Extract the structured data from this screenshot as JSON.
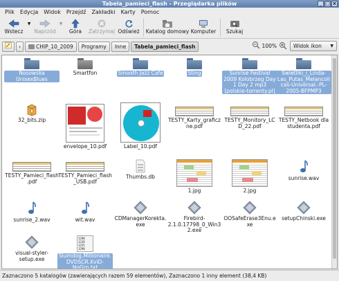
{
  "window": {
    "title": "Tabela_pamieci_flash - Przeglądarka plików",
    "controls": [
      "_",
      "□",
      "x"
    ]
  },
  "menu": [
    "Plik",
    "Edycja",
    "Widok",
    "Przejdź",
    "Zakładki",
    "Karty",
    "Pomoc"
  ],
  "toolbar": {
    "back": "Wstecz",
    "forward": "Naprzód",
    "up": "Góra",
    "stop": "Zatrzymaj",
    "reload": "Odśwież",
    "home": "Katalog domowy",
    "computer": "Komputer",
    "search": "Szukaj"
  },
  "location": {
    "path": [
      "CHIP_10_2009",
      "Programy",
      "Inne",
      "Tabela_pamieci_flash"
    ],
    "zoom": "100%",
    "view": "Widok ikon"
  },
  "files": [
    {
      "name": "Nosowska UnisexBlues",
      "kind": "folder",
      "selected": true
    },
    {
      "name": "Smartfon",
      "kind": "folder",
      "selected": false
    },
    {
      "name": "Smooth Jazz Cafe",
      "kind": "folder",
      "selected": true
    },
    {
      "name": "Sting",
      "kind": "folder",
      "selected": true
    },
    {
      "name": "Sunrise Festival 2009 Kołobrzeg Day 1 Day 2 mp3 [polskie-torrenty.pl]",
      "kind": "folder",
      "selected": true
    },
    {
      "name": "Swietliki_i_Linda-Las_Putas_Melancolicas-Universal.-PL-2005-BFPMP3",
      "kind": "folder",
      "selected": true
    },
    {
      "name": "32_bits.zip",
      "kind": "zip",
      "selected": false
    },
    {
      "name": "envelope_10.pdf",
      "kind": "pdf-envelope",
      "selected": false
    },
    {
      "name": "Label_10.pdf",
      "kind": "pdf-cd",
      "selected": false
    },
    {
      "name": "TESTY_Karty_graficzne.pdf",
      "kind": "pdf-table",
      "selected": false
    },
    {
      "name": "TESTY_Monitory_LCD_22.pdf",
      "kind": "pdf-table",
      "selected": false
    },
    {
      "name": "TESTY_Netbook dla studenta.pdf",
      "kind": "pdf-table",
      "selected": false
    },
    {
      "name": "TESTY_Pamieci_flash.pdf",
      "kind": "pdf-table",
      "selected": false
    },
    {
      "name": "TESTY_Pamieci_flash_USB.pdf",
      "kind": "pdf-table",
      "selected": false
    },
    {
      "name": "Thumbs.db",
      "kind": "db",
      "selected": false
    },
    {
      "name": "1.jpg",
      "kind": "sheet",
      "selected": false
    },
    {
      "name": "2.jpg",
      "kind": "sheet",
      "selected": false
    },
    {
      "name": "sunrise.wav",
      "kind": "audio",
      "selected": false
    },
    {
      "name": "sunrise_2.wav",
      "kind": "audio",
      "selected": false
    },
    {
      "name": "wit.wav",
      "kind": "audio",
      "selected": false
    },
    {
      "name": "CDManagerKorekta.exe",
      "kind": "exe",
      "selected": false
    },
    {
      "name": "Firebird-2.1.0.17798_0_Win32.exe",
      "kind": "exe",
      "selected": false
    },
    {
      "name": "OOSafeErase3Enu.exe",
      "kind": "exe",
      "selected": false
    },
    {
      "name": "setupChinski.exe",
      "kind": "exe",
      "selected": false
    },
    {
      "name": "visual-styler-setup.exe",
      "kind": "exe",
      "selected": false
    },
    {
      "name": "Slumdog.Millionaire.DVDSCR.XviD-NoGrp.txt",
      "kind": "txt",
      "selected": true
    }
  ],
  "txt_preview": "1290\n1239\n1255\n1290",
  "status": "Zaznaczono 5 katalogów (zawierających razem 59 elementów), Zaznaczono 1 inny element (38,4 KB)",
  "colors": {
    "selection": "#86abd9",
    "title_bar": "#6a89b5"
  }
}
